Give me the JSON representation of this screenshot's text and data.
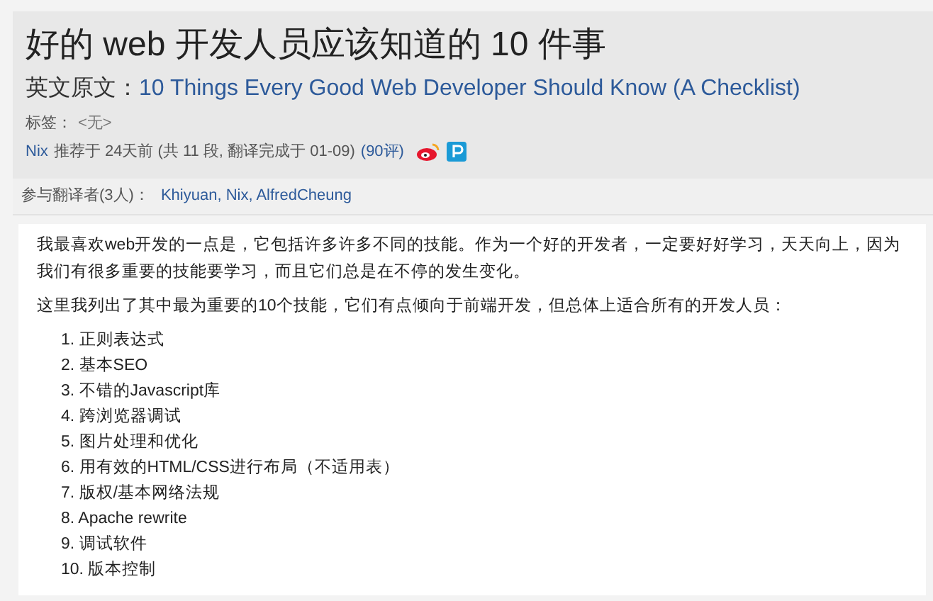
{
  "title": "好的 web 开发人员应该知道的 10 件事",
  "original": {
    "label": "英文原文：",
    "link": "10 Things Every Good Web Developer Should Know (A Checklist)"
  },
  "tags": {
    "label": "标签：",
    "value": "<无>"
  },
  "meta": {
    "author": "Nix",
    "text": "推荐于 24天前 (共 11 段, 翻译完成于 01-09)",
    "comments": "(90评)"
  },
  "translators": {
    "label": "参与翻译者(3人)：",
    "names": "Khiyuan, Nix, AlfredCheung"
  },
  "paragraphs": [
    "我最喜欢web开发的一点是，它包括许多许多不同的技能。作为一个好的开发者，一定要好好学习，天天向上，因为我们有很多重要的技能要学习，而且它们总是在不停的发生变化。",
    "这里我列出了其中最为重要的10个技能，它们有点倾向于前端开发，但总体上适合所有的开发人员："
  ],
  "list": [
    "1. 正则表达式",
    "2. 基本SEO",
    "3. 不错的Javascript库",
    "4. 跨浏览器调试",
    "5. 图片处理和优化",
    "6. 用有效的HTML/CSS进行布局（不适用表）",
    "7. 版权/基本网络法规",
    "8. Apache rewrite",
    "9. 调试软件",
    "10. 版本控制"
  ]
}
